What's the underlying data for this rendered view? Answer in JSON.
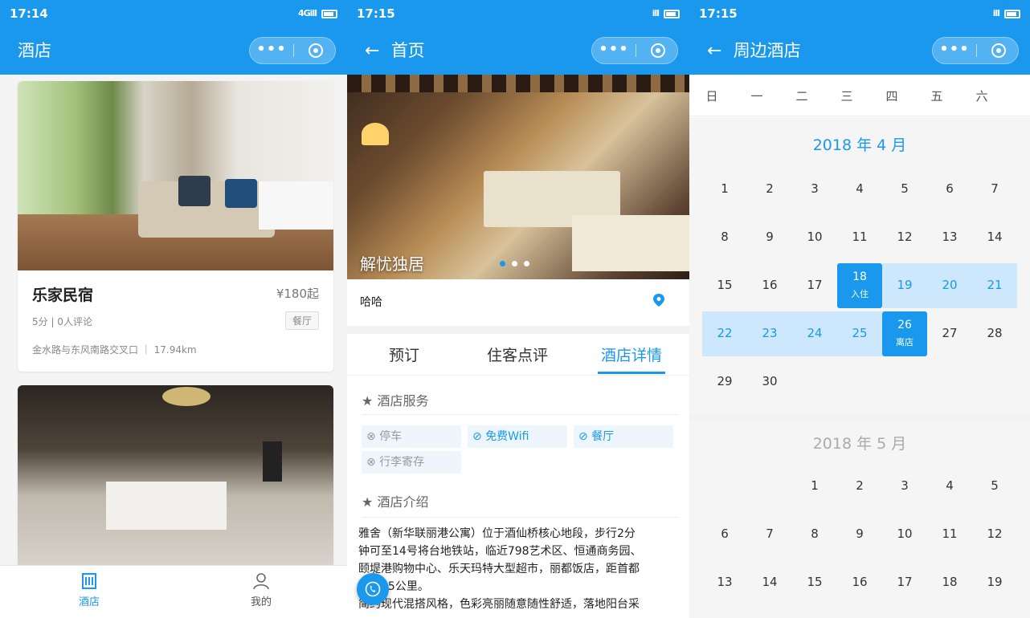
{
  "colors": {
    "primary": "#1a98ee",
    "range": "#cde8fc"
  },
  "screen1": {
    "time": "17:14",
    "signal": "4Gill",
    "title": "酒店",
    "card1": {
      "name": "乐家民宿",
      "price": "¥180起",
      "rating": "5分 | 0人评论",
      "tag": "餐厅",
      "address": "金水路与东风南路交叉口 ｜ 17.94km"
    },
    "tabbar": {
      "hotel": "酒店",
      "mine": "我的"
    }
  },
  "screen2": {
    "time": "17:15",
    "signal": "ill",
    "title": "首页",
    "banner_caption": "解忧独居",
    "banner_pages": 3,
    "banner_active": 1,
    "hotel_sub": "哈哈",
    "tabs": [
      "预订",
      "住客点评",
      "酒店详情"
    ],
    "active_tab": "酒店详情",
    "services_title": "酒店服务",
    "services": [
      {
        "label": "停车",
        "icon": "⊗",
        "available": false
      },
      {
        "label": "免费Wifi",
        "icon": "⊘",
        "available": true
      },
      {
        "label": "餐厅",
        "icon": "⊘",
        "available": true
      },
      {
        "label": "行李寄存",
        "icon": "⊗",
        "available": false
      }
    ],
    "intro_title": "酒店介绍",
    "intro_lines": [
      "雅舍（新华联丽港公寓）位于酒仙桥核心地段，步行2分",
      "钟可至14号将台地铁站，临近798艺术区、恒通商务园、",
      "颐堤港购物中心、乐天玛特大型超市，丽都饭店，距首都",
      "机场15公里。",
      "简约现代混搭风格，色彩亮丽随意随性舒适，落地阳台采"
    ]
  },
  "screen3": {
    "time": "17:15",
    "signal": "ill",
    "title": "周边酒店",
    "weekdays": [
      "日",
      "一",
      "二",
      "三",
      "四",
      "五",
      "六"
    ],
    "april": {
      "title": "2018 年 4 月",
      "rows": [
        [
          "1",
          "2",
          "3",
          "4",
          "5",
          "6",
          "7"
        ],
        [
          "8",
          "9",
          "10",
          "11",
          "12",
          "13",
          "14"
        ],
        [
          "15",
          "16",
          "17",
          "18",
          "19",
          "20",
          "21"
        ],
        [
          "22",
          "23",
          "24",
          "25",
          "26",
          "27",
          "28"
        ],
        [
          "29",
          "30",
          "",
          "",
          "",
          "",
          ""
        ]
      ],
      "checkin_day": "18",
      "checkin_label": "入住",
      "checkout_day": "26",
      "checkout_label": "离店",
      "range_days": [
        "19",
        "20",
        "21",
        "22",
        "23",
        "24",
        "25"
      ]
    },
    "may": {
      "title": "2018 年 5 月",
      "rows": [
        [
          "",
          "",
          "1",
          "2",
          "3",
          "4",
          "5"
        ],
        [
          "6",
          "7",
          "8",
          "9",
          "10",
          "11",
          "12"
        ],
        [
          "13",
          "14",
          "15",
          "16",
          "17",
          "18",
          "19"
        ]
      ]
    }
  }
}
